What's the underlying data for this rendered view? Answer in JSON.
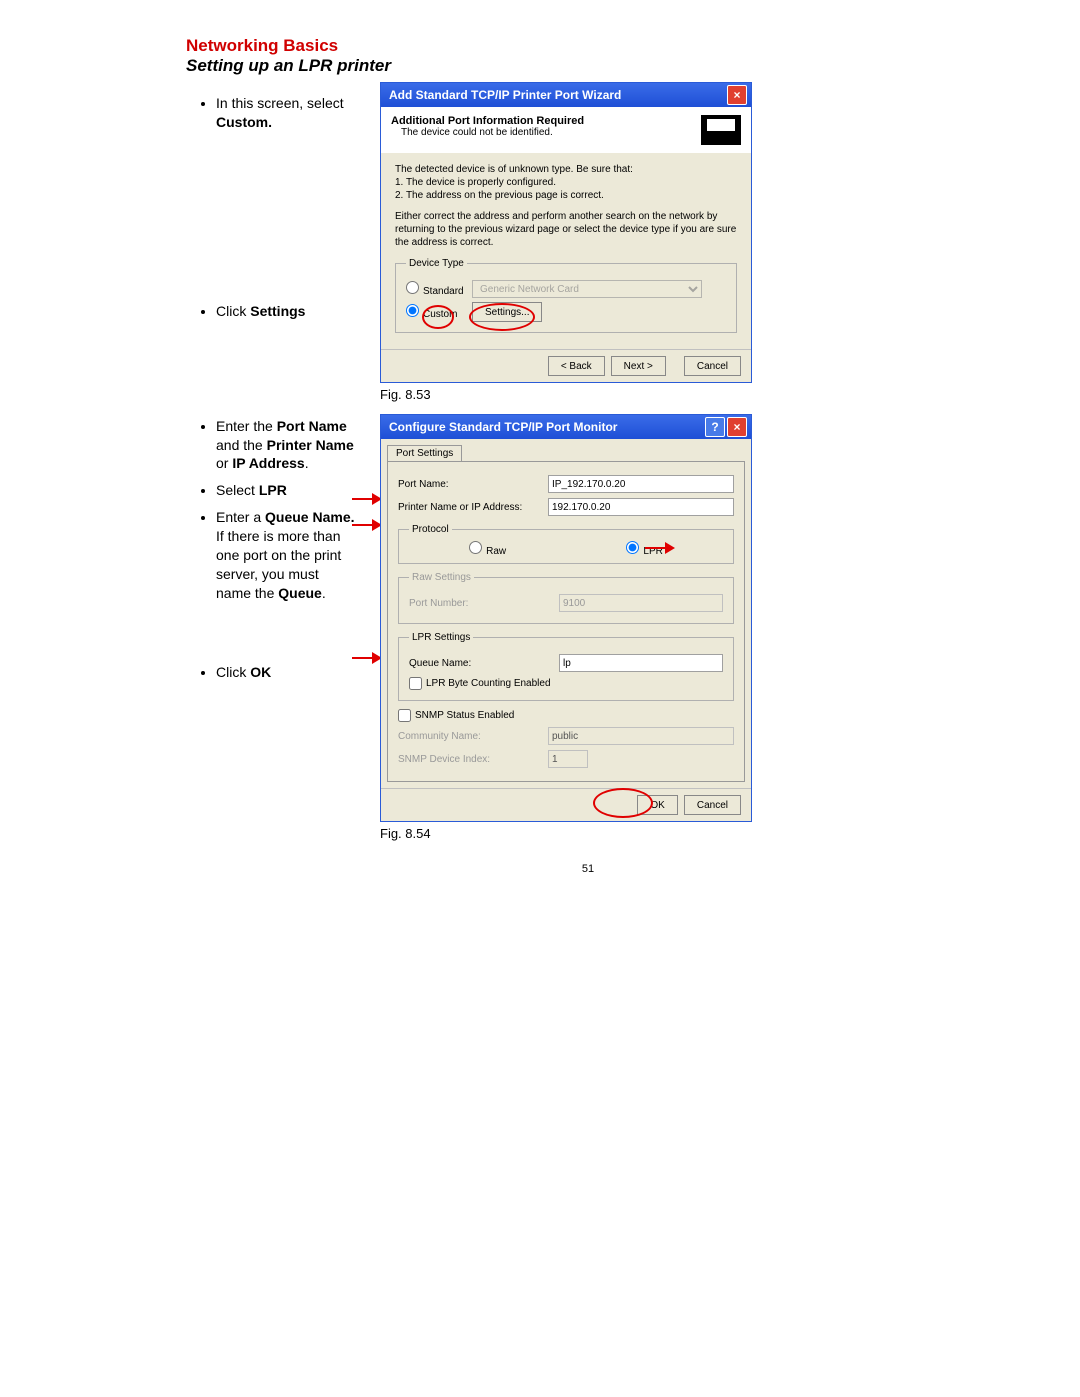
{
  "header": {
    "title": "Networking Basics",
    "subtitle": "Setting up an LPR printer"
  },
  "instructions": {
    "i1a": "In this screen, select ",
    "i1b": "Custom.",
    "i2a": "Click ",
    "i2b": "Settings",
    "i3a": "Enter the ",
    "i3b": "Port Name",
    "i3c": " and the ",
    "i3d": "Printer Name",
    "i3e": " or ",
    "i3f": "IP Address",
    "i3g": ".",
    "i4a": "Select ",
    "i4b": "LPR",
    "i5a": "Enter a ",
    "i5b": "Queue Name.",
    "i5c": "  If there is more than one port on the print server, you must name the ",
    "i5d": "Queue",
    "i5e": ".",
    "i6a": "Click ",
    "i6b": "OK"
  },
  "wizard": {
    "title": "Add Standard TCP/IP Printer Port Wizard",
    "head1": "Additional Port Information Required",
    "head2": "The device could not be identified.",
    "body1": "The detected device is of unknown type. Be sure that:",
    "body2": "1. The device is properly configured.",
    "body3": "2. The address on the previous page is correct.",
    "body4": "Either correct the address and perform another search on the network by returning to the previous wizard page or select the device type if you are sure the address is correct.",
    "devtype_legend": "Device Type",
    "radio_standard": "Standard",
    "radio_custom": "Custom",
    "dropdown": "Generic Network Card",
    "settings_btn": "Settings...",
    "back": "< Back",
    "next": "Next >",
    "cancel": "Cancel"
  },
  "fig1": "Fig. 8.53",
  "fig2": "Fig. 8.54",
  "config": {
    "title": "Configure Standard TCP/IP Port Monitor",
    "tab": "Port Settings",
    "portname_lab": "Port Name:",
    "portname_val": "IP_192.170.0.20",
    "addr_lab": "Printer Name or IP Address:",
    "addr_val": "192.170.0.20",
    "protocol_legend": "Protocol",
    "raw": "Raw",
    "lpr": "LPR",
    "raw_legend": "Raw Settings",
    "portnum_lab": "Port Number:",
    "portnum_val": "9100",
    "lpr_legend": "LPR Settings",
    "queue_lab": "Queue Name:",
    "queue_val": "lp",
    "lpr_byte": "LPR Byte Counting Enabled",
    "snmp_chk": "SNMP Status Enabled",
    "comm_lab": "Community Name:",
    "comm_val": "public",
    "snmp_idx_lab": "SNMP Device Index:",
    "snmp_idx_val": "1",
    "ok": "OK",
    "cancel": "Cancel"
  },
  "page_number": "51"
}
